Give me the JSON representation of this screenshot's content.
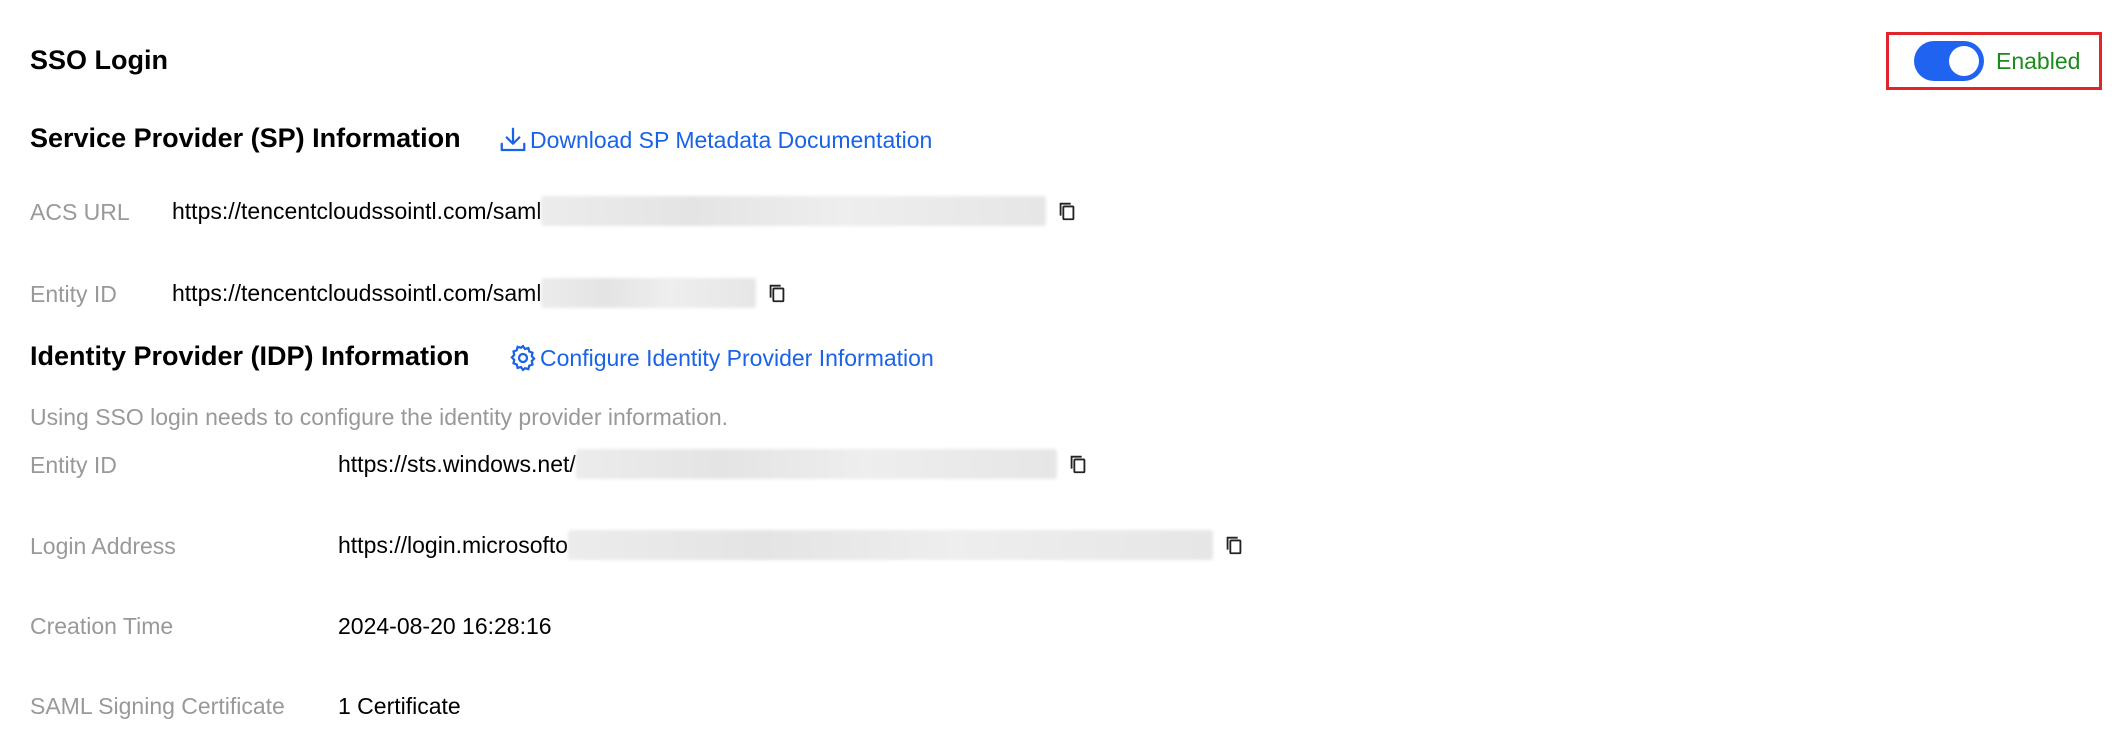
{
  "header": {
    "title": "SSO Login",
    "toggle": {
      "state": "on",
      "label": "Enabled",
      "color": "#1f63f0"
    }
  },
  "sp": {
    "title": "Service Provider (SP) Information",
    "download_link": "Download SP Metadata Documentation",
    "rows": [
      {
        "label": "ACS URL",
        "value": "https://tencentcloudssointl.com/saml"
      },
      {
        "label": "Entity ID",
        "value": "https://tencentcloudssointl.com/saml"
      }
    ]
  },
  "idp": {
    "title": "Identity Provider (IDP) Information",
    "configure_link": "Configure Identity Provider Information",
    "hint": "Using SSO login needs to configure the identity provider information.",
    "rows": [
      {
        "label": "Entity ID",
        "value": "https://sts.windows.net/"
      },
      {
        "label": "Login Address",
        "value": "https://login.microsofto"
      },
      {
        "label": "Creation Time",
        "value": "2024-08-20 16:28:16"
      },
      {
        "label": "SAML Signing Certificate",
        "value": "1 Certificate"
      }
    ]
  },
  "icons": {
    "download": "download-icon",
    "gear": "gear-icon",
    "copy": "copy-icon"
  },
  "colors": {
    "link": "#1a63e8",
    "enabled_text": "#1c8a1c",
    "highlight_border": "#e0252b"
  }
}
